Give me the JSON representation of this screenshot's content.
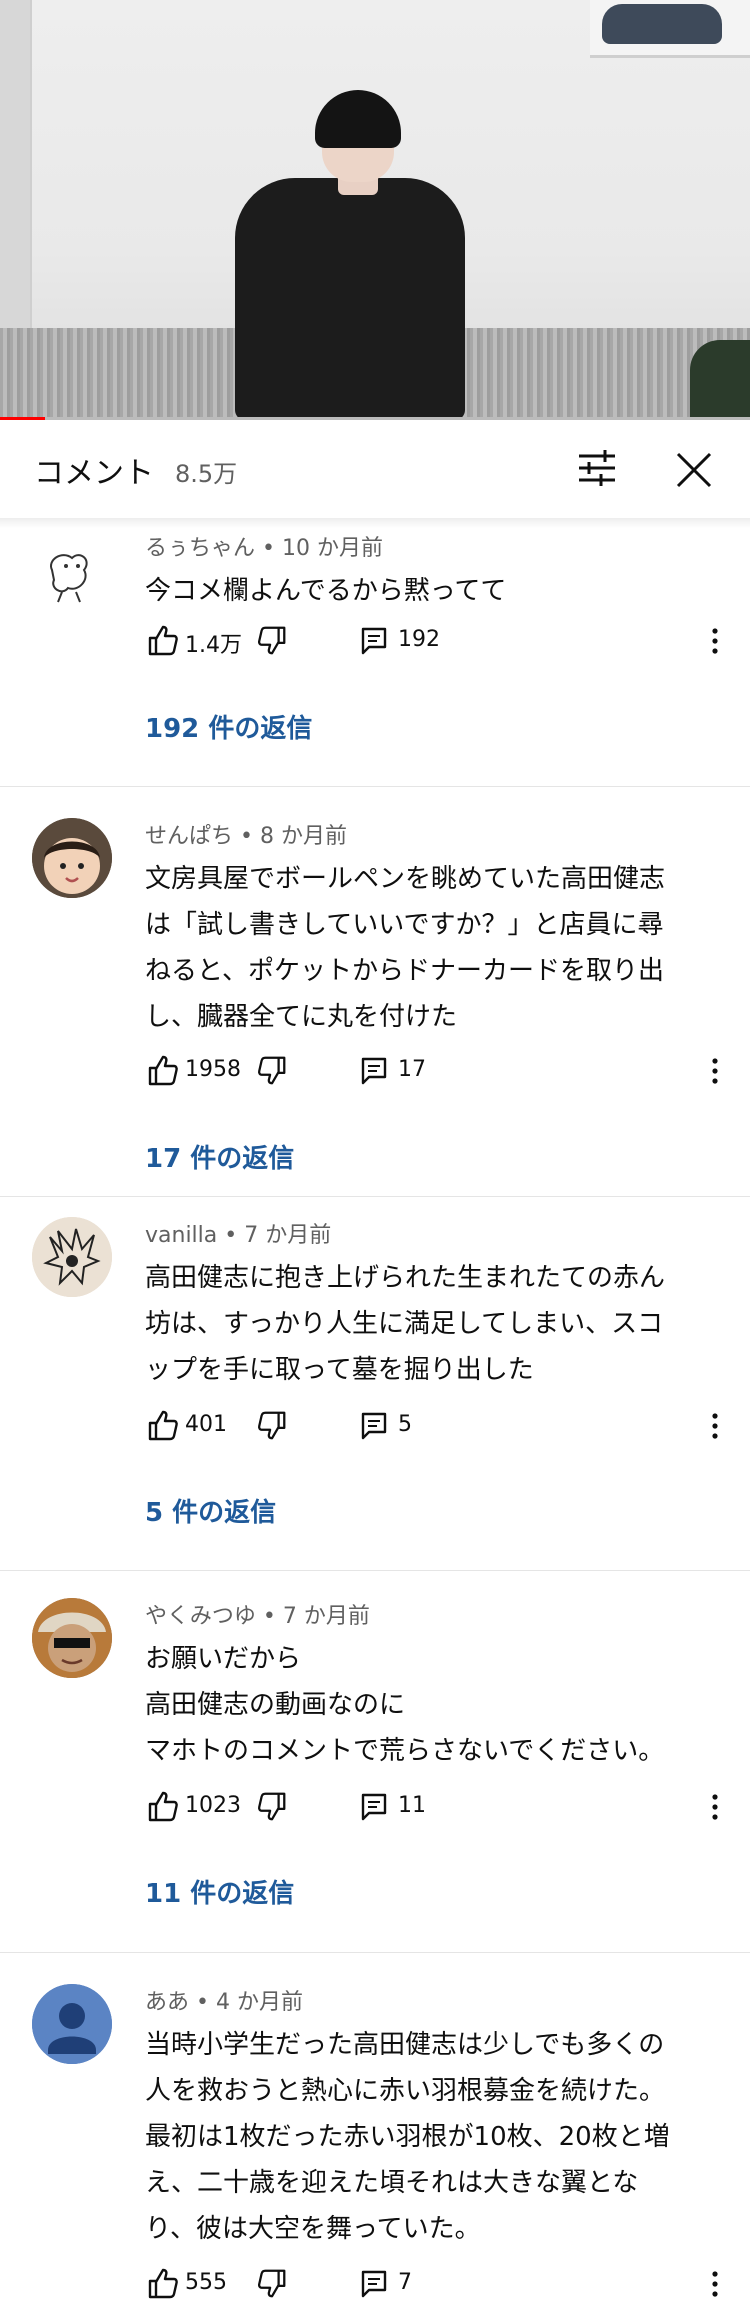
{
  "video": {
    "progress_fraction": 0.06
  },
  "header": {
    "title": "コメント",
    "count": "8.5万"
  },
  "comments": [
    {
      "author": "るぅちゃん",
      "time": "10 か月前",
      "lines": [
        "今コメ欄よんでるから黙ってて"
      ],
      "likes": "1.4万",
      "replies": "192",
      "replies_link": "192 件の返信"
    },
    {
      "author": "せんぱち",
      "time": "8 か月前",
      "lines": [
        "文房具屋でボールペンを眺めていた高田健志",
        "は「試し書きしていいですか？」と店員に尋",
        "ねると、ポケットからドナーカードを取り出",
        "し、臓器全てに丸を付けた"
      ],
      "likes": "1958",
      "replies": "17",
      "replies_link": "17 件の返信"
    },
    {
      "author": "vanilla",
      "time": "7 か月前",
      "lines": [
        "高田健志に抱き上げられた生まれたての赤ん",
        "坊は、すっかり人生に満足してしまい、スコ",
        "ップを手に取って墓を掘り出した"
      ],
      "likes": "401",
      "replies": "5",
      "replies_link": "5 件の返信"
    },
    {
      "author": "やくみつゆ",
      "time": "7 か月前",
      "lines": [
        "お願いだから",
        "高田健志の動画なのに",
        "マホトのコメントで荒らさないでください。"
      ],
      "likes": "1023",
      "replies": "11",
      "replies_link": "11 件の返信"
    },
    {
      "author": "ああ",
      "time": "4 か月前",
      "lines": [
        "当時小学生だった高田健志は少しでも多くの",
        "人を救おうと熱心に赤い羽根募金を続けた。",
        "最初は1枚だった赤い羽根が10枚、20枚と増",
        "え、二十歳を迎えた頃それは大きな翼とな",
        "り、彼は大空を舞っていた。"
      ],
      "likes": "555",
      "replies": "7"
    }
  ],
  "meta_separator": " • ",
  "icons": {
    "filter": "sliders-icon",
    "close": "close-icon",
    "like": "thumbs-up-icon",
    "dislike": "thumbs-down-icon",
    "reply": "reply-icon",
    "more": "more-vert-icon"
  },
  "colors": {
    "link": "#1f5a9a",
    "secondary_text": "#606060",
    "progress": "#ff0000"
  }
}
